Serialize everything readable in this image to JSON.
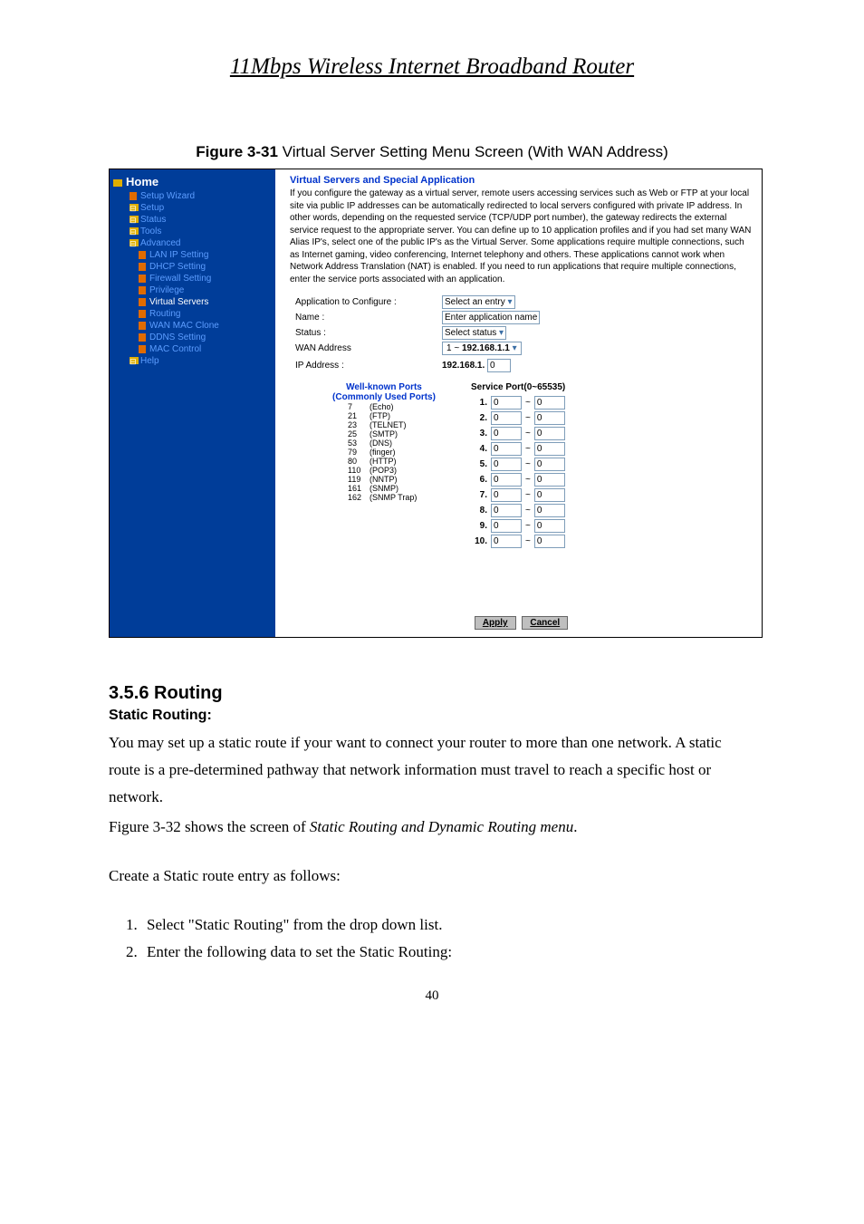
{
  "doc_title": "11Mbps  Wireless  Internet  Broadband  Router",
  "figure_caption_bold": "Figure 3-31 ",
  "figure_caption_rest": "Virtual Server Setting Menu Screen (With WAN Address)",
  "sidebar": {
    "home": "Home",
    "items": [
      {
        "label": "Setup Wizard",
        "cls": "side-page side-sub"
      },
      {
        "label": "Setup",
        "cls": "side-exp side-folder side-sub"
      },
      {
        "label": "Status",
        "cls": "side-exp side-folder side-sub"
      },
      {
        "label": "Tools",
        "cls": "side-exp side-folder side-sub"
      },
      {
        "label": "Advanced",
        "cls": "side-exp side-folder side-sub"
      },
      {
        "label": "LAN IP Setting",
        "cls": "side-page side-sub2"
      },
      {
        "label": "DHCP Setting",
        "cls": "side-page side-sub2"
      },
      {
        "label": "Firewall Setting",
        "cls": "side-page side-sub2"
      },
      {
        "label": "Privilege",
        "cls": "side-page side-sub2"
      },
      {
        "label": "Virtual Servers",
        "cls": "side-page side-sub2 side-active"
      },
      {
        "label": "Routing",
        "cls": "side-page side-sub2"
      },
      {
        "label": "WAN MAC Clone",
        "cls": "side-page side-sub2"
      },
      {
        "label": "DDNS Setting",
        "cls": "side-page side-sub2"
      },
      {
        "label": "MAC Control",
        "cls": "side-page side-sub2"
      },
      {
        "label": "Help",
        "cls": "side-exp side-folder side-sub"
      }
    ]
  },
  "panel": {
    "title": "Virtual Servers and Special Application",
    "desc": "If you configure the gateway as a virtual server, remote users accessing services such as Web or FTP at your local site via public IP addresses can be automatically redirected to local servers configured with private IP address. In other words, depending on the requested service (TCP/UDP port number), the gateway redirects the external service request to the appropriate server.\nYou can define up to 10 application profiles and if you had set many WAN Alias IP's, select one of the public IP's as the Virtual Server. Some applications require multiple connections, such as Internet gaming, video conferencing, Internet telephony and others. These applications cannot work when Network Address Translation (NAT) is enabled. If you need to run applications that require multiple connections, enter the service ports associated with an application.",
    "rows": {
      "app_cfg_lbl": "Application to Configure :",
      "app_cfg_val": "Select an entry",
      "name_lbl": "Name :",
      "name_val": "Enter application name",
      "status_lbl": "Status :",
      "status_val": "Select status",
      "wan_lbl": "WAN Address",
      "wan_prefix": "1 ~ ",
      "wan_val": "192.168.1.1",
      "ip_lbl": "IP Address :",
      "ip_prefix": "192.168.1.",
      "ip_val": "0"
    },
    "sp_header": "Service Port(0~65535)",
    "ports": [
      {
        "n": "1.",
        "a": "0",
        "b": "0"
      },
      {
        "n": "2.",
        "a": "0",
        "b": "0"
      },
      {
        "n": "3.",
        "a": "0",
        "b": "0"
      },
      {
        "n": "4.",
        "a": "0",
        "b": "0"
      },
      {
        "n": "5.",
        "a": "0",
        "b": "0"
      },
      {
        "n": "6.",
        "a": "0",
        "b": "0"
      },
      {
        "n": "7.",
        "a": "0",
        "b": "0"
      },
      {
        "n": "8.",
        "a": "0",
        "b": "0"
      },
      {
        "n": "9.",
        "a": "0",
        "b": "0"
      },
      {
        "n": "10.",
        "a": "0",
        "b": "0"
      }
    ],
    "wk": {
      "title1": "Well-known Ports",
      "title2": "(Commonly Used Ports)",
      "list": [
        {
          "p": "7",
          "n": "(Echo)"
        },
        {
          "p": "21",
          "n": "(FTP)"
        },
        {
          "p": "23",
          "n": "(TELNET)"
        },
        {
          "p": "25",
          "n": "(SMTP)"
        },
        {
          "p": "53",
          "n": "(DNS)"
        },
        {
          "p": "79",
          "n": "(finger)"
        },
        {
          "p": "80",
          "n": "(HTTP)"
        },
        {
          "p": "110",
          "n": "(POP3)"
        },
        {
          "p": "119",
          "n": "(NNTP)"
        },
        {
          "p": "161",
          "n": "(SNMP)"
        },
        {
          "p": "162",
          "n": "(SNMP Trap)"
        }
      ]
    },
    "btn_apply": "Apply",
    "btn_cancel": "Cancel"
  },
  "body": {
    "h": "3.5.6 Routing",
    "sub": "Static Routing:",
    "p1": "You may set up a static route if your want to connect your router to more than one network. A static route is a pre-determined pathway that network information must travel to reach a specific host or network.",
    "p2a": "Figure 3-32 shows the screen of ",
    "p2b": "Static Routing and Dynamic Routing menu",
    "p2c": ".",
    "p3": "Create a Static route entry as follows:",
    "li1": "Select \"Static Routing\" from the drop down list.",
    "li2": "Enter the following data to set the Static Routing:"
  },
  "page_no": "40"
}
